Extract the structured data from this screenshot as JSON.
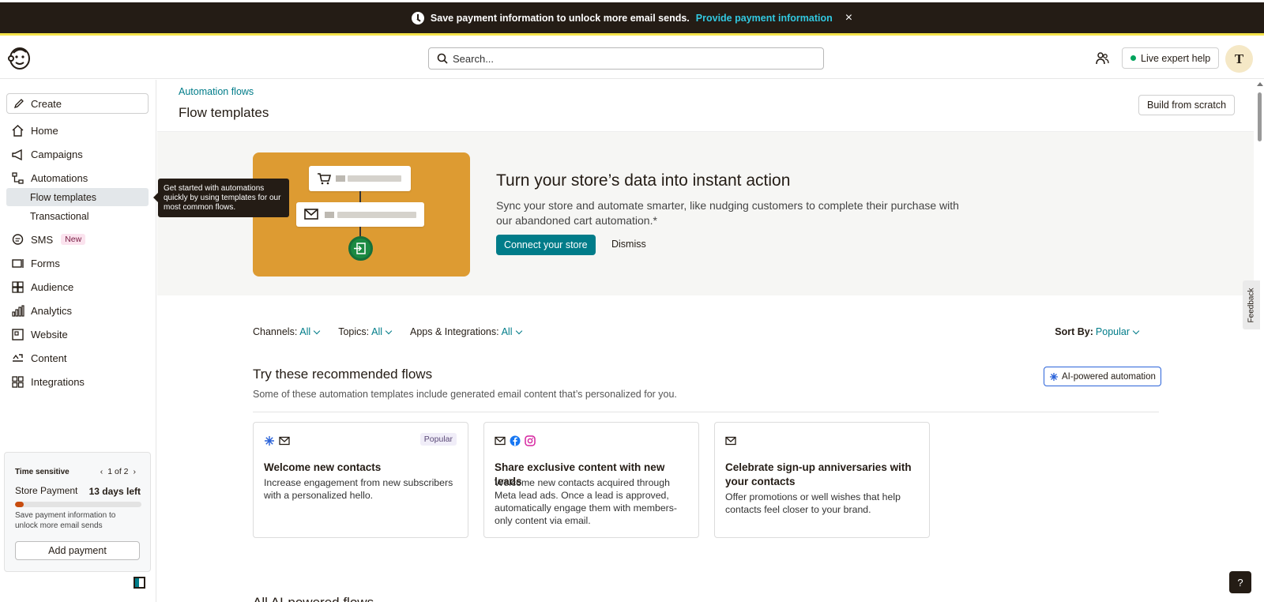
{
  "banner": {
    "message": "Save payment information to unlock more email sends.",
    "link": "Provide payment information",
    "close": "×"
  },
  "header": {
    "search_placeholder": "Search...",
    "live_help": "Live expert help",
    "avatar_initial": "T"
  },
  "sidebar": {
    "create": "Create",
    "items": [
      {
        "label": "Home",
        "icon": "home-icon"
      },
      {
        "label": "Campaigns",
        "icon": "megaphone-icon"
      },
      {
        "label": "Automations",
        "icon": "automations-icon"
      },
      {
        "label": "SMS",
        "icon": "sms-icon",
        "badge": "New"
      },
      {
        "label": "Forms",
        "icon": "forms-icon"
      },
      {
        "label": "Audience",
        "icon": "audience-icon"
      },
      {
        "label": "Analytics",
        "icon": "analytics-icon"
      },
      {
        "label": "Website",
        "icon": "website-icon"
      },
      {
        "label": "Content",
        "icon": "content-icon"
      },
      {
        "label": "Integrations",
        "icon": "integrations-icon"
      }
    ],
    "sub_items": [
      "Flow templates",
      "Transactional"
    ],
    "tooltip": "Get started with automations quickly by using templates for our most common flows.",
    "time_card": {
      "label": "Time sensitive",
      "pager": "1 of 2",
      "title": "Store Payment",
      "days": "13 days left",
      "progress_fraction": 0.07,
      "desc": "Save payment information to unlock more email sends",
      "button": "Add payment"
    }
  },
  "main": {
    "breadcrumb": "Automation flows",
    "title": "Flow templates",
    "build_button": "Build from scratch",
    "hero": {
      "title": "Turn your store’s data into instant action",
      "desc": "Sync your store and automate smarter, like nudging customers to complete their purchase with our abandoned cart automation.*",
      "connect": "Connect your store",
      "dismiss": "Dismiss"
    },
    "filters": [
      {
        "label": "Channels:",
        "value": "All"
      },
      {
        "label": "Topics:",
        "value": "All"
      },
      {
        "label": "Apps & Integrations:",
        "value": "All"
      }
    ],
    "sort": {
      "label": "Sort By:",
      "value": "Popular"
    },
    "recommended": {
      "title": "Try these recommended flows",
      "desc": "Some of these automation templates include generated email content that’s personalized for you.",
      "ai_button": "AI-powered automation"
    },
    "cards": [
      {
        "title": "Welcome new contacts",
        "desc": "Increase engagement from new subscribers with a personalized hello.",
        "badge": "Popular",
        "icons": [
          "ai-sparkle-icon",
          "email-icon"
        ]
      },
      {
        "title": "Share exclusive content with new leads",
        "desc": "Welcome new contacts acquired through Meta lead ads. Once a lead is approved, automatically engage them with members-only content via email.",
        "icons": [
          "email-icon",
          "facebook-icon",
          "instagram-icon"
        ]
      },
      {
        "title": "Celebrate sign-up anniversaries with your contacts",
        "desc": "Offer promotions or well wishes that help contacts feel closer to your brand.",
        "icons": [
          "email-icon"
        ]
      }
    ],
    "all_ai_title": "All AI-powered flows"
  },
  "feedback": "Feedback",
  "help": "?",
  "colors": {
    "accent": "#007c89",
    "banner": "#241c15",
    "hero_image": "#dd9b32"
  }
}
